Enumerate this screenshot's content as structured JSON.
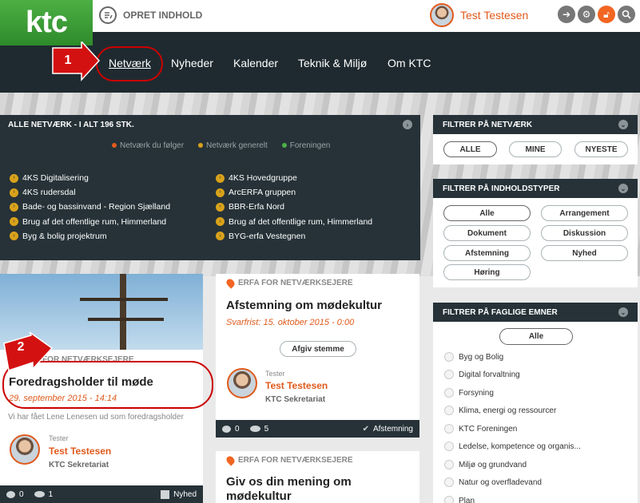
{
  "brand": {
    "logo": "ktc"
  },
  "header": {
    "create_label": "OPRET INDHOLD",
    "user_name": "Test Testesen",
    "tool_icons": [
      "pin-icon",
      "gear-icon",
      "lock-icon",
      "search-icon"
    ]
  },
  "nav": {
    "items": [
      "Netværk",
      "Nyheder",
      "Kalender",
      "Teknik & Miljø",
      "Om KTC"
    ],
    "active": "Netværk"
  },
  "annotations": [
    "1",
    "2"
  ],
  "networks_panel": {
    "title": "ALLE NETVÆRK - I ALT 196 STK.",
    "legend": [
      {
        "label": "Netværk du følger",
        "color": "#e05a1c"
      },
      {
        "label": "Netværk generelt",
        "color": "#d9a21b"
      },
      {
        "label": "Foreningen",
        "color": "#4caf44"
      }
    ],
    "col1": [
      "4KS Digitalisering",
      "4KS rudersdal",
      "Bade- og bassinvand - Region Sjælland",
      "Brug af det offentlige rum, Himmerland",
      "Byg & bolig projektrum"
    ],
    "col2": [
      "4KS Hovedgruppe",
      "ArcERFA gruppen",
      "BBR-Erfa Nord",
      "Brug af det offentlige rum, Himmerland",
      "BYG-erfa Vestegnen"
    ]
  },
  "filter_network": {
    "title": "FILTRER PÅ NETVÆRK",
    "options": [
      "ALLE",
      "MINE",
      "NYESTE"
    ],
    "selected": "ALLE"
  },
  "filter_content": {
    "title": "FILTRER PÅ INDHOLDSTYPER",
    "options": [
      "Alle",
      "Arrangement",
      "Dokument",
      "Diskussion",
      "Afstemning",
      "Nyhed",
      "Høring"
    ],
    "selected": "Alle"
  },
  "filter_topics": {
    "title": "FILTRER PÅ FAGLIGE EMNER",
    "all_label": "Alle",
    "items": [
      "Byg og Bolig",
      "Digital forvaltning",
      "Forsyning",
      "Klima, energi og ressourcer",
      "KTC Foreningen",
      "Ledelse, kompetence og organis...",
      "Miljø og grundvand",
      "Natur og overfladevand",
      "Plan"
    ]
  },
  "cards": {
    "news": {
      "category": "ERFA FOR NETVÆRKSEJERE",
      "title": "Foredragsholder til møde",
      "date": "29. september 2015 - 14:14",
      "excerpt": "Vi har fået Lene Lenesen ud som foredragsholder",
      "role": "Tester",
      "author": "Test Testesen",
      "org": "KTC Sekretariat",
      "comments": "0",
      "views": "1",
      "type": "Nyhed"
    },
    "poll": {
      "category": "ERFA FOR NETVÆRKSEJERE",
      "title": "Afstemning om mødekultur",
      "deadline": "Svarfrist: 15. oktober 2015 - 0:00",
      "button": "Afgiv stemme",
      "role": "Tester",
      "author": "Test Testesen",
      "org": "KTC Sekretariat",
      "comments": "0",
      "views": "5",
      "type": "Afstemning"
    },
    "third": {
      "category": "ERFA FOR NETVÆRKSEJERE",
      "title_line1": "Giv os din mening om",
      "title_line2": "mødekultur"
    }
  }
}
